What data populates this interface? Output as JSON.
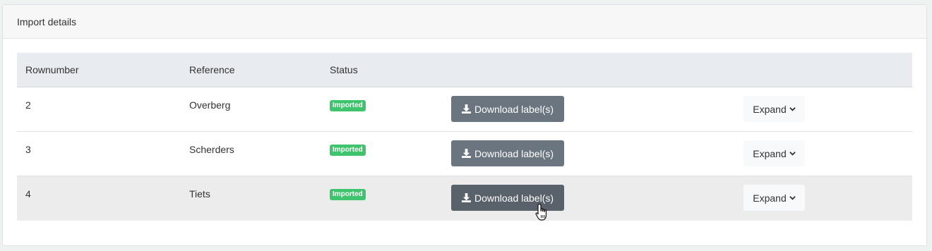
{
  "card": {
    "title": "Import details"
  },
  "table": {
    "headers": [
      "Rownumber",
      "Reference",
      "Status"
    ],
    "rows": [
      {
        "rownumber": "2",
        "reference": "Overberg",
        "status": "Imported",
        "download_label": "Download label(s)",
        "expand_label": "Expand"
      },
      {
        "rownumber": "3",
        "reference": "Scherders",
        "status": "Imported",
        "download_label": "Download label(s)",
        "expand_label": "Expand"
      },
      {
        "rownumber": "4",
        "reference": "Tiets",
        "status": "Imported",
        "download_label": "Download label(s)",
        "expand_label": "Expand"
      }
    ]
  },
  "icons": {
    "download": "download-icon",
    "expand": "chevron-down-icon",
    "cursor": "hand-pointer-cursor"
  },
  "colors": {
    "badge": "#3ec46d",
    "download_button": "#6b7580",
    "row_hover": "#ececec",
    "header_bg": "#e8ebef"
  }
}
